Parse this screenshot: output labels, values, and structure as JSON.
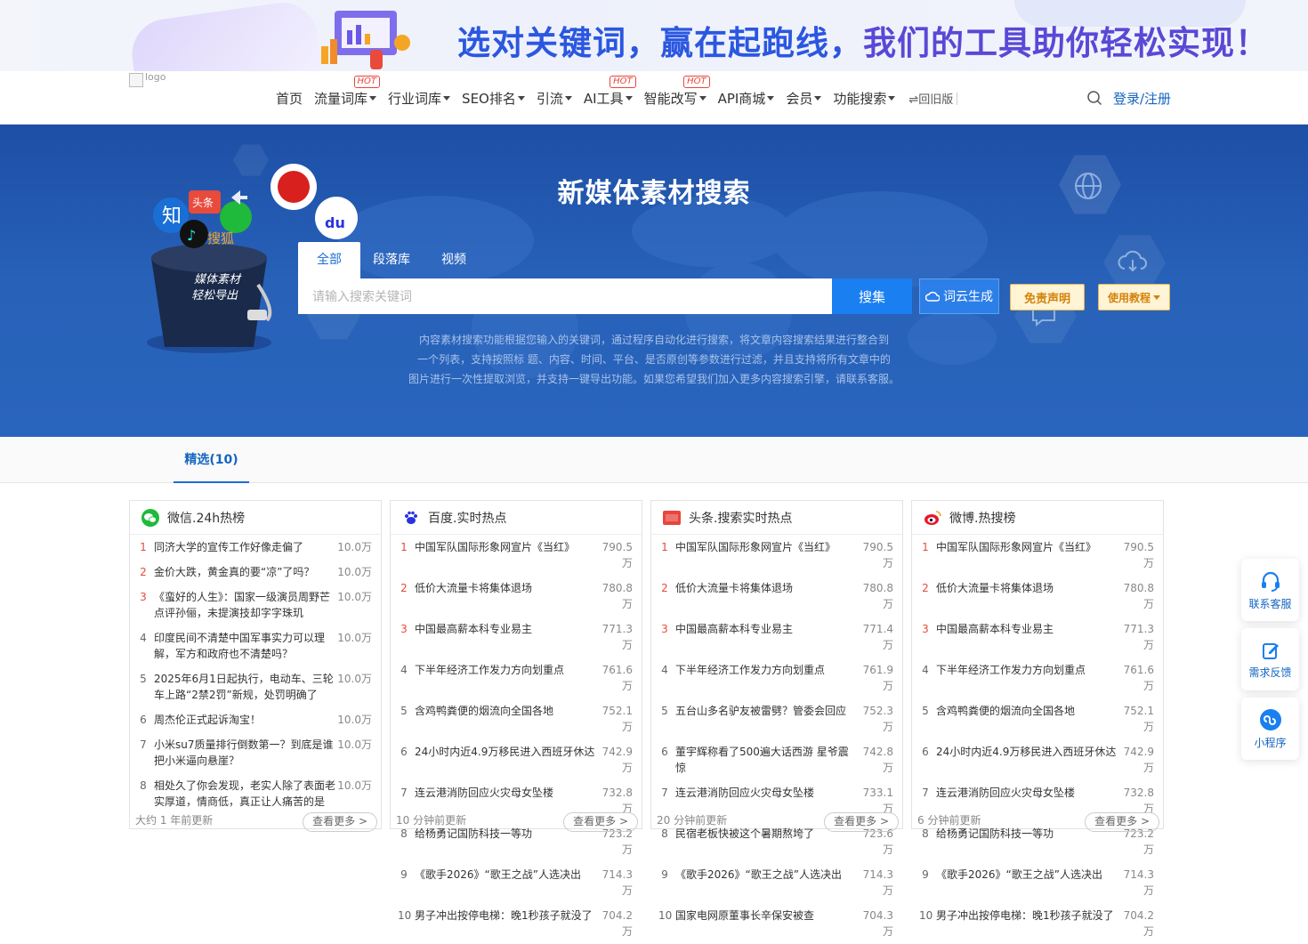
{
  "banner": {
    "text_blue": "选对关键词，赢在起跑线，",
    "text_purple": "我们的工具助你轻松实现！"
  },
  "header": {
    "logo_alt": "logo",
    "menu": [
      {
        "label": "首页",
        "caret": false,
        "hot": ""
      },
      {
        "label": "流量词库",
        "caret": true,
        "hot": "HOT"
      },
      {
        "label": "行业词库",
        "caret": true,
        "hot": ""
      },
      {
        "label": "SEO排名",
        "caret": true,
        "hot": ""
      },
      {
        "label": "引流",
        "caret": true,
        "hot": ""
      },
      {
        "label": "AI工具",
        "caret": true,
        "hot": "HOT"
      },
      {
        "label": "智能改写",
        "caret": true,
        "hot": "HOT"
      },
      {
        "label": "API商城",
        "caret": true,
        "hot": ""
      },
      {
        "label": "会员",
        "caret": true,
        "hot": ""
      },
      {
        "label": "功能搜索",
        "caret": true,
        "hot": ""
      }
    ],
    "back_old": "⇌回旧版",
    "login": "登录/注册",
    "search_icon": "search-icon"
  },
  "hero": {
    "title": "新媒体素材搜索",
    "bucket_text_1": "媒体素材",
    "bucket_text_2": "轻松导出",
    "tabs": [
      "全部",
      "段落库",
      "视频"
    ],
    "active_tab": "全部",
    "search_placeholder": "请输入搜索关键词",
    "search_button": "搜集",
    "cloud_button": "词云生成",
    "disclaimer_button": "免责声明",
    "tutorial_button": "使用教程",
    "description_lines": [
      "内容素材搜索功能根据您输入的关键词，通过程序自动化进行搜索，将文章内容搜索结果进行整合到",
      "一个列表，支持按照标 题、内容、时间、平台、是否原创等参数进行过滤，并且支持将所有文章中的",
      "图片进行一次性提取浏览，并支持一键导出功能。如果您希望我们加入更多内容搜索引擎，请联系客服。"
    ]
  },
  "subtab": "精选(10)",
  "cards": [
    {
      "title": "微信.24h热榜",
      "icon": "wechat-icon",
      "items": [
        {
          "n": "1",
          "t": "同济大学的宣传工作好像走偏了",
          "v": "10.0万"
        },
        {
          "n": "2",
          "t": "金价大跌，黄金真的要“凉”了吗？",
          "v": "10.0万"
        },
        {
          "n": "3",
          "t": "《蛮好的人生》：国家一级演员周野芒点评孙俪，未提演技却字字珠玑",
          "v": "10.0万"
        },
        {
          "n": "4",
          "t": "印度民间不清楚中国军事实力可以理解，军方和政府也不清楚吗？",
          "v": "10.0万"
        },
        {
          "n": "5",
          "t": "2025年6月1日起执行，电动车、三轮车上路“2禁2罚”新规，处罚明确了",
          "v": "10.0万"
        },
        {
          "n": "6",
          "t": "周杰伦正式起诉淘宝！",
          "v": "10.0万"
        },
        {
          "n": "7",
          "t": "小米su7质量排行倒数第一？到底是谁把小米逼向悬崖？",
          "v": "10.0万"
        },
        {
          "n": "8",
          "t": "相处久了你会发现，老实人除了表面老实厚道，情商低，真正让人痛苦的是",
          "v": "10.0万"
        }
      ],
      "footer": "大约 1 年前更新",
      "more": "查看更多 >"
    },
    {
      "title": "百度.实时热点",
      "icon": "baidu-paw-icon",
      "items": [
        {
          "n": "1",
          "t": "中国军队国际形象网宣片《当红》",
          "v": "790.5万"
        },
        {
          "n": "2",
          "t": "低价大流量卡将集体退场",
          "v": "780.8万"
        },
        {
          "n": "3",
          "t": "中国最高薪本科专业易主",
          "v": "771.3万"
        },
        {
          "n": "4",
          "t": "下半年经济工作发力方向划重点",
          "v": "761.6万"
        },
        {
          "n": "5",
          "t": "含鸡鸭粪便的烟流向全国各地",
          "v": "752.1万"
        },
        {
          "n": "6",
          "t": "24小时内近4.9万移民进入西班牙休达",
          "v": "742.9万"
        },
        {
          "n": "7",
          "t": "连云港消防回应火灾母女坠楼",
          "v": "732.8万"
        },
        {
          "n": "8",
          "t": "给杨勇记国防科技一等功",
          "v": "723.2万"
        },
        {
          "n": "9",
          "t": "《歌手2026》“歌王之战”人选决出",
          "v": "714.3万"
        },
        {
          "n": "10",
          "t": "男子冲出按停电梯：晚1秒孩子就没了",
          "v": "704.2万"
        }
      ],
      "footer": "10 分钟前更新",
      "more": "查看更多 >"
    },
    {
      "title": "头条.搜索实时热点",
      "icon": "toutiao-icon",
      "items": [
        {
          "n": "1",
          "t": "中国军队国际形象网宣片《当红》",
          "v": "790.5万"
        },
        {
          "n": "2",
          "t": "低价大流量卡将集体退场",
          "v": "780.8万"
        },
        {
          "n": "3",
          "t": "中国最高薪本科专业易主",
          "v": "771.4万"
        },
        {
          "n": "4",
          "t": "下半年经济工作发力方向划重点",
          "v": "761.9万"
        },
        {
          "n": "5",
          "t": "五台山多名驴友被雷劈？管委会回应",
          "v": "752.3万"
        },
        {
          "n": "6",
          "t": "董宇辉称看了500遍大话西游 星爷震惊",
          "v": "742.8万"
        },
        {
          "n": "7",
          "t": "连云港消防回应火灾母女坠楼",
          "v": "733.1万"
        },
        {
          "n": "8",
          "t": "民宿老板快被这个暑期熬垮了",
          "v": "723.6万"
        },
        {
          "n": "9",
          "t": "《歌手2026》“歌王之战”人选决出",
          "v": "714.3万"
        },
        {
          "n": "10",
          "t": "国家电网原董事长辛保安被查",
          "v": "704.3万"
        }
      ],
      "footer": "20 分钟前更新",
      "more": "查看更多 >"
    },
    {
      "title": "微博.热搜榜",
      "icon": "weibo-icon",
      "items": [
        {
          "n": "1",
          "t": "中国军队国际形象网宣片《当红》",
          "v": "790.5万"
        },
        {
          "n": "2",
          "t": "低价大流量卡将集体退场",
          "v": "780.8万"
        },
        {
          "n": "3",
          "t": "中国最高薪本科专业易主",
          "v": "771.3万"
        },
        {
          "n": "4",
          "t": "下半年经济工作发力方向划重点",
          "v": "761.6万"
        },
        {
          "n": "5",
          "t": "含鸡鸭粪便的烟流向全国各地",
          "v": "752.1万"
        },
        {
          "n": "6",
          "t": "24小时内近4.9万移民进入西班牙休达",
          "v": "742.9万"
        },
        {
          "n": "7",
          "t": "连云港消防回应火灾母女坠楼",
          "v": "732.8万"
        },
        {
          "n": "8",
          "t": "给杨勇记国防科技一等功",
          "v": "723.2万"
        },
        {
          "n": "9",
          "t": "《歌手2026》“歌王之战”人选决出",
          "v": "714.3万"
        },
        {
          "n": "10",
          "t": "男子冲出按停电梯：晚1秒孩子就没了",
          "v": "704.2万"
        }
      ],
      "footer": "6 分钟前更新",
      "more": "查看更多 >"
    }
  ],
  "float_buttons": [
    {
      "label": "联系客服",
      "icon": "headset-icon"
    },
    {
      "label": "需求反馈",
      "icon": "edit-icon"
    },
    {
      "label": "小程序",
      "icon": "mini-program-icon"
    }
  ],
  "colors": {
    "primary": "#1a7ff0",
    "hero_bg": "#2761b8",
    "hot": "#e8453c",
    "warn": "#d4820a"
  }
}
